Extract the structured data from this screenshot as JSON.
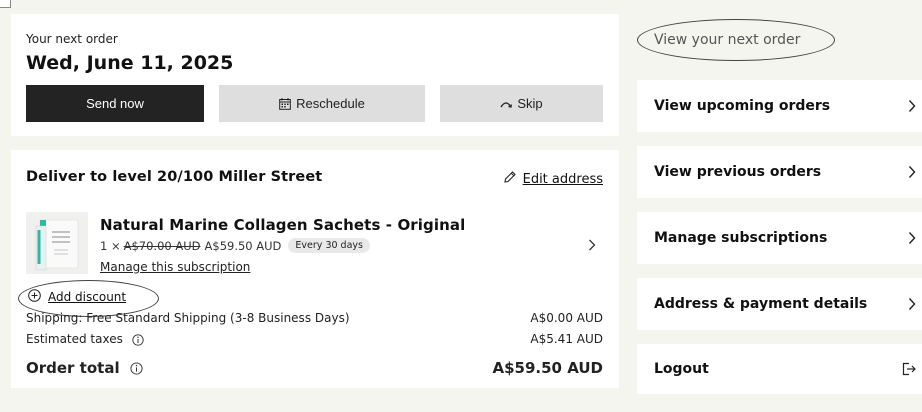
{
  "next_order": {
    "label": "Your next order",
    "date": "Wed, June 11, 2025",
    "send_now": "Send now",
    "reschedule": "Reschedule",
    "skip": "Skip"
  },
  "delivery": {
    "title": "Deliver to level 20/100 Miller Street",
    "edit_address": "Edit address",
    "product": {
      "name": "Natural Marine Collagen Sachets - Original",
      "quantity": "1 ×",
      "original_price": "A$70.00 AUD",
      "price": "A$59.50 AUD",
      "frequency_badge": "Every 30 days",
      "manage_link": "Manage this subscription"
    },
    "add_discount": "Add discount",
    "shipping_label": "Shipping: Free Standard Shipping (3-8 Business Days)",
    "shipping_value": "A$0.00 AUD",
    "taxes_label": "Estimated taxes",
    "taxes_value": "A$5.41 AUD",
    "total_label": "Order total",
    "total_value": "A$59.50 AUD"
  },
  "sidebar": {
    "view_next": "View your next order",
    "items": [
      {
        "label": "View upcoming orders",
        "icon": "chevron-right-icon"
      },
      {
        "label": "View previous orders",
        "icon": "chevron-right-icon"
      },
      {
        "label": "Manage subscriptions",
        "icon": "chevron-right-icon"
      },
      {
        "label": "Address & payment details",
        "icon": "chevron-right-icon"
      },
      {
        "label": "Logout",
        "icon": "logout-icon"
      }
    ]
  },
  "colors": {
    "page_bg": "#f5f5f0",
    "primary_button": "#232323",
    "secondary_button": "#dedede",
    "product_accent": "#2fb8a6"
  }
}
